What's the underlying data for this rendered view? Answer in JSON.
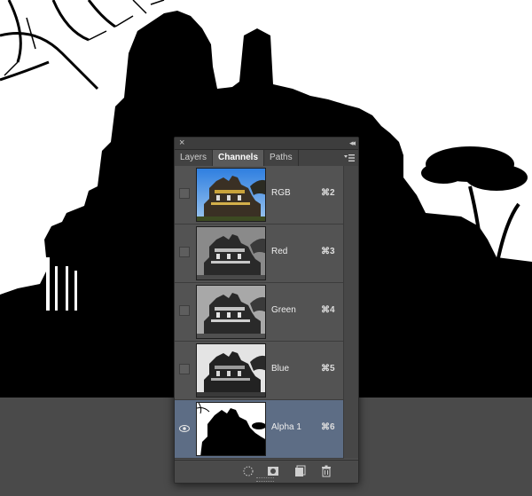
{
  "panel": {
    "close_glyph": "×",
    "collapse_glyph": "◂◂",
    "tabs": [
      {
        "label": "Layers",
        "active": false
      },
      {
        "label": "Channels",
        "active": true
      },
      {
        "label": "Paths",
        "active": false
      }
    ],
    "menu_icon": "panel-menu-icon",
    "channels": [
      {
        "name": "RGB",
        "shortcut": "⌘2",
        "visible": false,
        "selected": false,
        "thumb": "color"
      },
      {
        "name": "Red",
        "shortcut": "⌘3",
        "visible": false,
        "selected": false,
        "thumb": "gray"
      },
      {
        "name": "Green",
        "shortcut": "⌘4",
        "visible": false,
        "selected": false,
        "thumb": "gray"
      },
      {
        "name": "Blue",
        "shortcut": "⌘5",
        "visible": false,
        "selected": false,
        "thumb": "gray"
      },
      {
        "name": "Alpha 1",
        "shortcut": "⌘6",
        "visible": true,
        "selected": true,
        "thumb": "mask"
      }
    ],
    "bottom_buttons": [
      {
        "name": "load-channel-as-selection-icon"
      },
      {
        "name": "save-selection-as-channel-icon"
      },
      {
        "name": "new-channel-icon"
      },
      {
        "name": "delete-channel-icon"
      }
    ]
  },
  "colors": {
    "canvas_background": "#ffffff",
    "silhouette": "#000000",
    "floor": "#4a4a4a",
    "panel_bg": "#535353",
    "selected_row": "#5d6d85"
  }
}
